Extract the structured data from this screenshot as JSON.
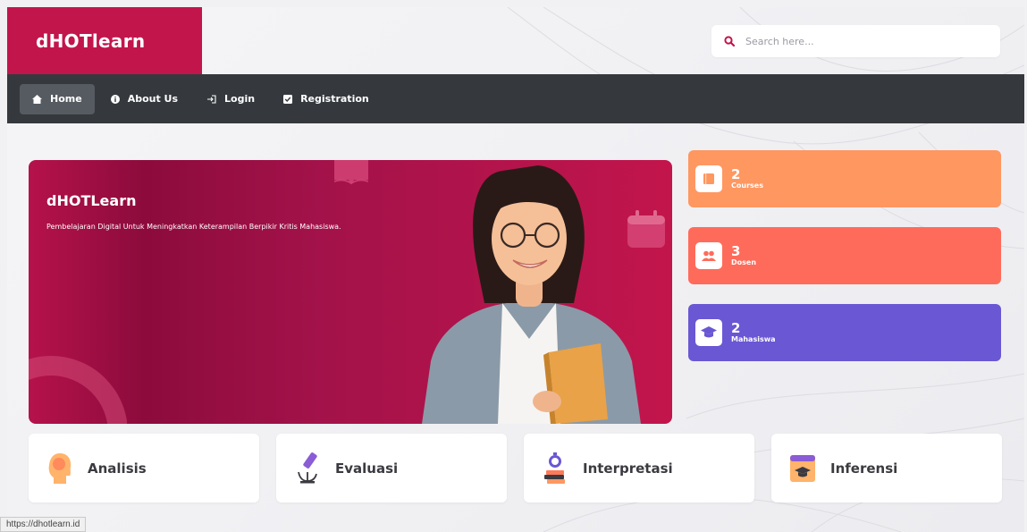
{
  "brand": {
    "name": "dHOTlearn",
    "accent": "#c2154c"
  },
  "search": {
    "placeholder": "Search here..."
  },
  "nav": {
    "items": [
      {
        "label": "Home",
        "icon": "home-icon",
        "active": true
      },
      {
        "label": "About Us",
        "icon": "info-icon",
        "active": false
      },
      {
        "label": "Login",
        "icon": "login-icon",
        "active": false
      },
      {
        "label": "Registration",
        "icon": "checkbox-icon",
        "active": false
      }
    ]
  },
  "hero": {
    "title": "dHOTLearn",
    "subtitle": "Pembelajaran Digital Untuk Meningkatkan Keterampilan Berpikir Kritis Mahasiswa."
  },
  "stats": [
    {
      "value": "2",
      "label": "Courses",
      "icon": "book-icon",
      "color": "#ff9761"
    },
    {
      "value": "3",
      "label": "Dosen",
      "icon": "users-icon",
      "color": "#ff6b5a"
    },
    {
      "value": "2",
      "label": "Mahasiswa",
      "icon": "graduation-cap-icon",
      "color": "#6a57d4"
    }
  ],
  "skills": [
    {
      "label": "Analisis",
      "icon": "head-icon"
    },
    {
      "label": "Evaluasi",
      "icon": "microscope-icon"
    },
    {
      "label": "Interpretasi",
      "icon": "stopwatch-books-icon"
    },
    {
      "label": "Inferensi",
      "icon": "browser-graduation-icon"
    }
  ],
  "status_bar": {
    "url": "https://dhotlearn.id"
  }
}
